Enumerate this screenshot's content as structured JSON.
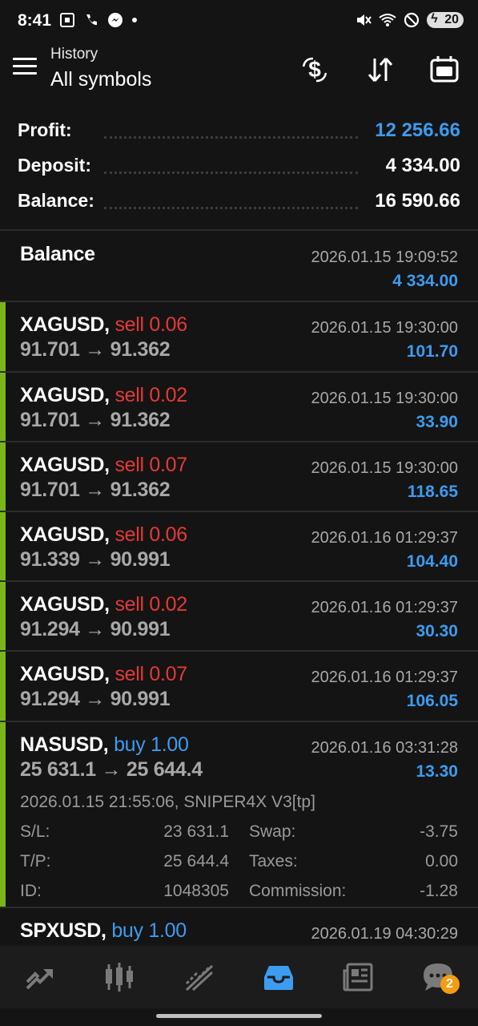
{
  "status_bar": {
    "time": "8:41",
    "battery": "20"
  },
  "header": {
    "title": "History",
    "subtitle": "All symbols"
  },
  "summary": {
    "profit_label": "Profit:",
    "profit_value": "12 256.66",
    "deposit_label": "Deposit:",
    "deposit_value": "4 334.00",
    "balance_label": "Balance:",
    "balance_value": "16 590.66"
  },
  "balance_entry": {
    "title": "Balance",
    "date": "2026.01.15 19:09:52",
    "amount": "4 334.00"
  },
  "trades": [
    {
      "symbol": "XAGUSD,",
      "direction": "sell 0.06",
      "prices": "91.701 → 91.362",
      "date": "2026.01.15 19:30:00",
      "amount": "101.70"
    },
    {
      "symbol": "XAGUSD,",
      "direction": "sell 0.02",
      "prices": "91.701 → 91.362",
      "date": "2026.01.15 19:30:00",
      "amount": "33.90"
    },
    {
      "symbol": "XAGUSD,",
      "direction": "sell 0.07",
      "prices": "91.701 → 91.362",
      "date": "2026.01.15 19:30:00",
      "amount": "118.65"
    },
    {
      "symbol": "XAGUSD,",
      "direction": "sell 0.06",
      "prices": "91.339 → 90.991",
      "date": "2026.01.16 01:29:37",
      "amount": "104.40"
    },
    {
      "symbol": "XAGUSD,",
      "direction": "sell 0.02",
      "prices": "91.294 → 90.991",
      "date": "2026.01.16 01:29:37",
      "amount": "30.30"
    },
    {
      "symbol": "XAGUSD,",
      "direction": "sell 0.07",
      "prices": "91.294 → 90.991",
      "date": "2026.01.16 01:29:37",
      "amount": "106.05"
    }
  ],
  "expanded_trade": {
    "symbol": "NASUSD,",
    "direction": "buy 1.00",
    "prices": "25 631.1 → 25 644.4",
    "date": "2026.01.16 03:31:28",
    "amount": "13.30",
    "open_info": "2026.01.15 21:55:06, SNIPER4X V3[tp]",
    "sl_label": "S/L:",
    "sl_value": "23 631.1",
    "swap_label": "Swap:",
    "swap_value": "-3.75",
    "tp_label": "T/P:",
    "tp_value": "25 644.4",
    "taxes_label": "Taxes:",
    "taxes_value": "0.00",
    "id_label": "ID:",
    "id_value": "1048305",
    "commission_label": "Commission:",
    "commission_value": "-1.28"
  },
  "partial_trade": {
    "symbol": "SPXUSD,",
    "direction": "buy 1.00",
    "date": "2026.01.19 04:30:29"
  },
  "bottom_nav": {
    "items": [
      "quotes-icon",
      "chart-icon",
      "trade-icon",
      "history-icon",
      "news-icon",
      "messages-icon"
    ],
    "messages_badge": "2"
  },
  "colors": {
    "accent_green": "#7cb518",
    "sell_red": "#e53935",
    "buy_blue": "#3c9cf0"
  }
}
